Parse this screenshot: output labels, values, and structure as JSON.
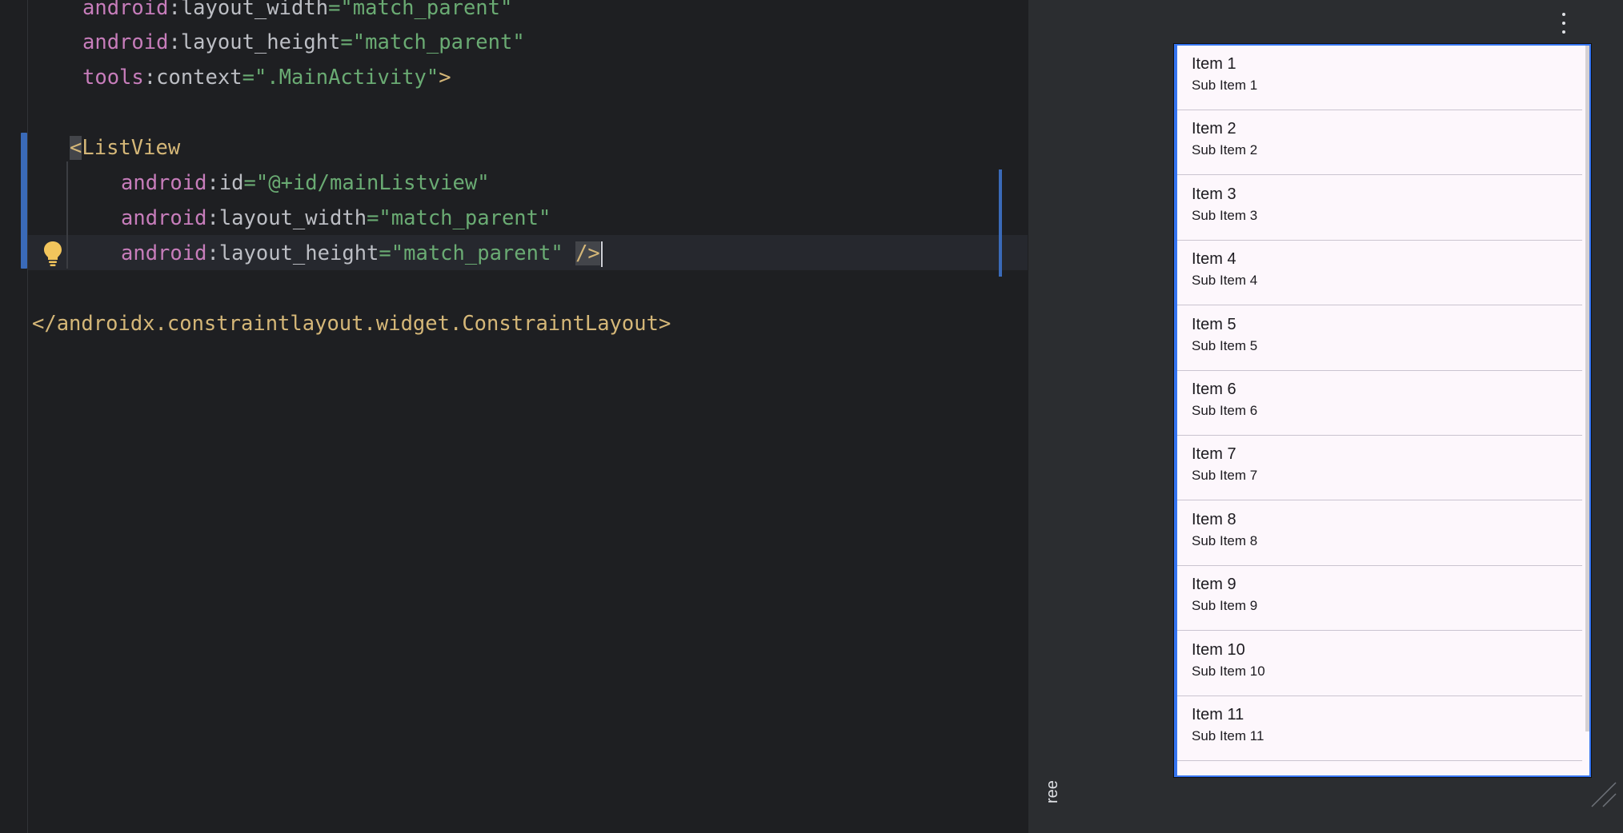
{
  "editor": {
    "lines": [
      {
        "ns": "android",
        "attr": ":layout_width",
        "eq": "=",
        "value": "\"match_parent\""
      },
      {
        "ns": "android",
        "attr": ":layout_height",
        "eq": "=",
        "value": "\"match_parent\""
      },
      {
        "ns": "tools",
        "attr": ":context",
        "eq": "=",
        "value": "\".MainActivity\"",
        "end": ">"
      },
      {
        "open_bracket": "<",
        "tag": "ListView"
      },
      {
        "ns": "android",
        "attr": ":id",
        "eq": "=",
        "value": "\"@+id/mainListview\""
      },
      {
        "ns": "android",
        "attr": ":layout_width",
        "eq": "=",
        "value": "\"match_parent\""
      },
      {
        "ns": "android",
        "attr": ":layout_height",
        "eq": "=",
        "value": "\"match_parent\"",
        "end": "/>"
      },
      {
        "closing_tag": "</androidx.constraintlayout.widget.ConstraintLayout>"
      }
    ]
  },
  "side_strip": {
    "label": "ree"
  },
  "preview": {
    "list_items": [
      {
        "title": "Item 1",
        "subtitle": "Sub Item 1"
      },
      {
        "title": "Item 2",
        "subtitle": "Sub Item 2"
      },
      {
        "title": "Item 3",
        "subtitle": "Sub Item 3"
      },
      {
        "title": "Item 4",
        "subtitle": "Sub Item 4"
      },
      {
        "title": "Item 5",
        "subtitle": "Sub Item 5"
      },
      {
        "title": "Item 6",
        "subtitle": "Sub Item 6"
      },
      {
        "title": "Item 7",
        "subtitle": "Sub Item 7"
      },
      {
        "title": "Item 8",
        "subtitle": "Sub Item 8"
      },
      {
        "title": "Item 9",
        "subtitle": "Sub Item 9"
      },
      {
        "title": "Item 10",
        "subtitle": "Sub Item 10"
      },
      {
        "title": "Item 11",
        "subtitle": "Sub Item 11"
      }
    ]
  },
  "colors": {
    "editor_bg": "#1e1f22",
    "namespace": "#c77dbb",
    "string": "#6aab73",
    "tag": "#d5b778",
    "selection_accent": "#3574f0"
  },
  "icons": [
    "lightbulb-icon",
    "kebab-menu-icon",
    "resize-handle-icon"
  ]
}
